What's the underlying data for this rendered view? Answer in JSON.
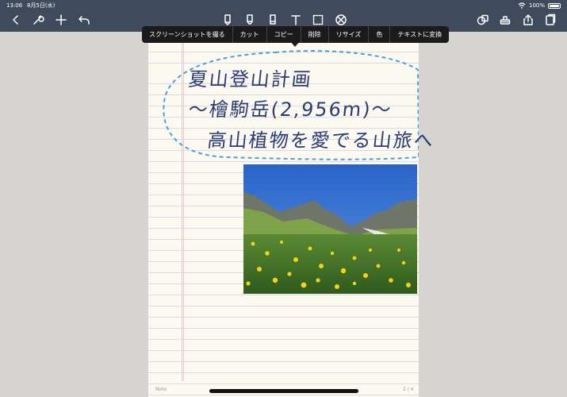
{
  "status": {
    "time": "13:06",
    "date": "8月5日(水)",
    "battery": "100%"
  },
  "toolbar": {
    "left_icons": [
      "chevron-left-icon",
      "wrench-icon",
      "plus-icon",
      "undo-icon"
    ],
    "center_tools": [
      "pen-icon",
      "highlighter-icon",
      "eraser-icon",
      "text-icon",
      "lasso-icon",
      "shape-icon"
    ],
    "right_icons": [
      "shapes-icon",
      "stamp-icon",
      "share-icon",
      "pages-icon"
    ]
  },
  "context_menu": {
    "items": [
      "スクリーンショットを撮る",
      "カット",
      "コピー",
      "削除",
      "リサイズ",
      "色",
      "テキストに変換"
    ]
  },
  "note": {
    "line1": "夏山登山計画",
    "line2": "〜檜駒岳(2,956m)〜",
    "line3": "高山植物を愛でる山旅へ",
    "footer_left": "Note",
    "footer_right": "2 / 4"
  },
  "colors": {
    "toolbar": "#3f4a5c",
    "ink": "#2a3a73",
    "lasso": "#4a9fe0",
    "paper": "#fbf9f0"
  }
}
